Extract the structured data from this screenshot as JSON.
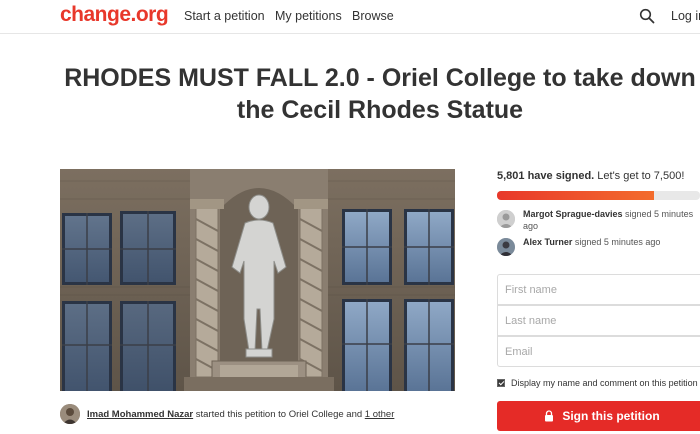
{
  "header": {
    "logo": "change.org",
    "nav": {
      "start": "Start a petition",
      "mine": "My petitions",
      "browse": "Browse"
    },
    "search_icon": "search-icon",
    "login": "Log in"
  },
  "petition": {
    "title": "RHODES MUST FALL 2.0 - Oriel College to take down the Cecil Rhodes Statue",
    "starter": {
      "name": "Imad Mohammed Nazar",
      "middle": " started this petition to ",
      "target": "Oriel College",
      "and": " and ",
      "other": "1 other"
    }
  },
  "sidebar": {
    "count_bold": "5,801 have signed.",
    "count_rest": " Let's get to 7,500!",
    "progress": 0.7735,
    "signers": [
      {
        "name": "Margot Sprague-davies",
        "action": " signed 5 minutes ago"
      },
      {
        "name": "Alex Turner",
        "action": " signed 5 minutes ago"
      }
    ],
    "form": {
      "first_name_placeholder": "First name",
      "last_name_placeholder": "Last name",
      "email_placeholder": "Email",
      "display_label": "Display my name and comment on this petition",
      "sign_label": "Sign this petition"
    }
  },
  "colors": {
    "brand": "#e8382b",
    "button": "#e52b27"
  }
}
